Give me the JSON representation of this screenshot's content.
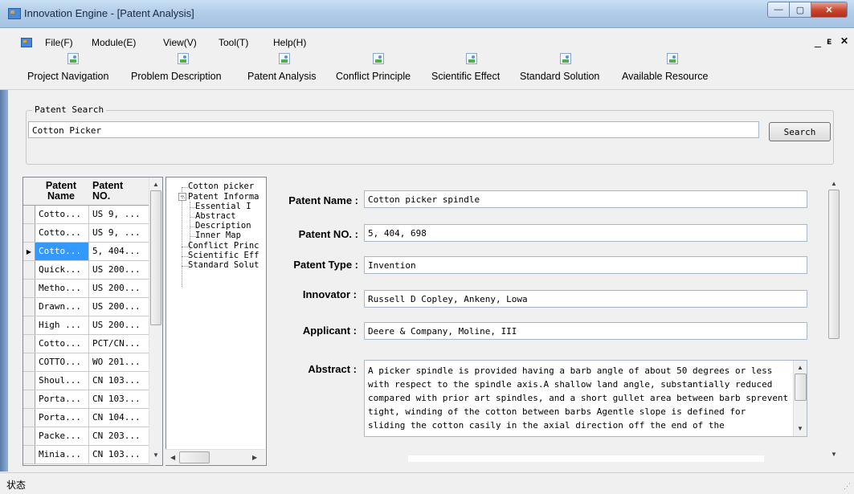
{
  "window": {
    "title": "Innovation Engine - [Patent Analysis]",
    "controls": {
      "minimize": "—",
      "maximize": "▢",
      "close": "✕"
    }
  },
  "menu": {
    "items": [
      "File(F)",
      "Module(E)",
      "View(V)",
      "Tool(T)",
      "Help(H)"
    ],
    "mdi_controls": {
      "minimize": "_",
      "restore": "🗗",
      "close": "✕"
    }
  },
  "toolbar": {
    "buttons": [
      {
        "label": "Project Navigation",
        "icon": "image-icon"
      },
      {
        "label": "Problem Description",
        "icon": "image-icon"
      },
      {
        "label": "Patent Analysis",
        "icon": "image-icon"
      },
      {
        "label": "Conflict Principle",
        "icon": "image-icon"
      },
      {
        "label": "Scientific Effect",
        "icon": "image-icon"
      },
      {
        "label": "Standard Solution",
        "icon": "image-icon"
      },
      {
        "label": "Available Resource",
        "icon": "image-icon"
      }
    ]
  },
  "search": {
    "group_label": "Patent Search",
    "value": "Cotton Picker",
    "button_label": "Search"
  },
  "grid": {
    "headers": [
      "Patent Name",
      "Patent NO."
    ],
    "rows": [
      [
        "Cotto...",
        "US 9, ..."
      ],
      [
        "Cotto...",
        "US 9, ..."
      ],
      [
        "Cotto...",
        "5, 404..."
      ],
      [
        "Quick...",
        "US 200..."
      ],
      [
        "Metho...",
        "US 200..."
      ],
      [
        "Drawn...",
        "US 200..."
      ],
      [
        "High ...",
        "US 200..."
      ],
      [
        "Cotto...",
        "PCT/CN..."
      ],
      [
        "COTTO...",
        "WO 201..."
      ],
      [
        "Shoul...",
        "CN 103..."
      ],
      [
        "Porta...",
        "CN 103..."
      ],
      [
        "Porta...",
        "CN 104..."
      ],
      [
        "Packe...",
        "CN 203..."
      ],
      [
        "Minia...",
        "CN 103..."
      ]
    ],
    "selected_index": 2
  },
  "tree": {
    "nodes": [
      {
        "label": "Cotton picker",
        "level": 0
      },
      {
        "label": "Patent Informa",
        "level": 0,
        "expander": "−"
      },
      {
        "label": "Essential I",
        "level": 1
      },
      {
        "label": "Abstract",
        "level": 1
      },
      {
        "label": "Description",
        "level": 1
      },
      {
        "label": "Inner Map",
        "level": 1
      },
      {
        "label": "Conflict Princ",
        "level": 0
      },
      {
        "label": "Scientific Eff",
        "level": 0
      },
      {
        "label": "Standard Solut",
        "level": 0
      }
    ]
  },
  "detail": {
    "patent_name_label": "Patent Name :",
    "patent_name": "Cotton picker spindle",
    "patent_no_label": "Patent NO. :",
    "patent_no": "5, 404, 698",
    "patent_type_label": "Patent Type :",
    "patent_type": "Invention",
    "innovator_label": "Innovator :",
    "innovator": "Russell D Copley, Ankeny, Lowa",
    "applicant_label": "Applicant :",
    "applicant": "Deere & Company, Moline, III",
    "abstract_label": "Abstract :",
    "abstract": "A picker spindle is provided having a barb angle of about 50 degrees or less\nwith respect to the spindle axis.A shallow land angle, substantially reduced\ncompared with prior art spindles, and a short gullet area between barb sprevent\ntight, winding of the cotton between barbs Agentle slope is defined for\nsliding the cotton casily in the axial direction off the end of the"
  },
  "status": {
    "text": "状态"
  }
}
